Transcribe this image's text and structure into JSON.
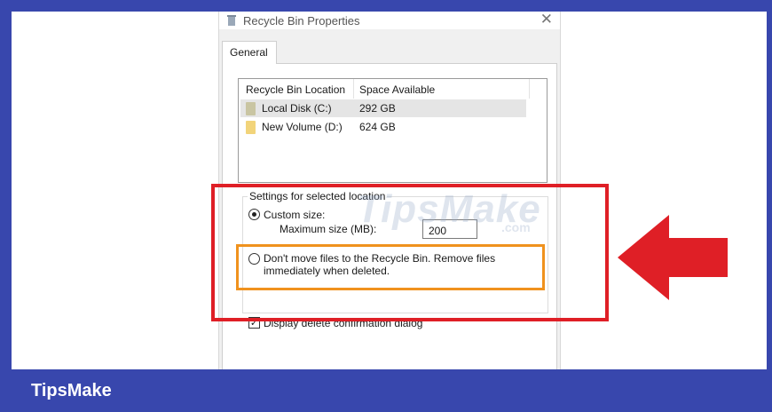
{
  "brand": {
    "name": "TipsMake"
  },
  "dialog": {
    "title": "Recycle Bin Properties",
    "close_glyph": "✕",
    "tab_general": "General"
  },
  "list": {
    "headers": [
      "Recycle Bin Location",
      "Space Available"
    ],
    "rows": [
      {
        "name": "Local Disk (C:)",
        "space": "292 GB",
        "selected": true
      },
      {
        "name": "New Volume (D:)",
        "space": "624 GB",
        "selected": false
      }
    ]
  },
  "settings": {
    "group_title": "Settings for selected location",
    "custom_size_label": "Custom size:",
    "max_size_label": "Maximum size (MB):",
    "max_size_value": "200",
    "dont_move_line1": "Don't move files to the Recycle Bin. Remove files",
    "dont_move_line2": "immediately when deleted.",
    "confirm_label": "Display delete confirmation dialog",
    "custom_size_selected": true,
    "confirm_checked": true
  },
  "watermark": {
    "text": "TipsMake",
    "suffix": ".com"
  },
  "colors": {
    "frame": "#3847ad",
    "highlight_red": "#df1f26",
    "highlight_orange": "#f0921e",
    "arrow": "#df1f26"
  }
}
